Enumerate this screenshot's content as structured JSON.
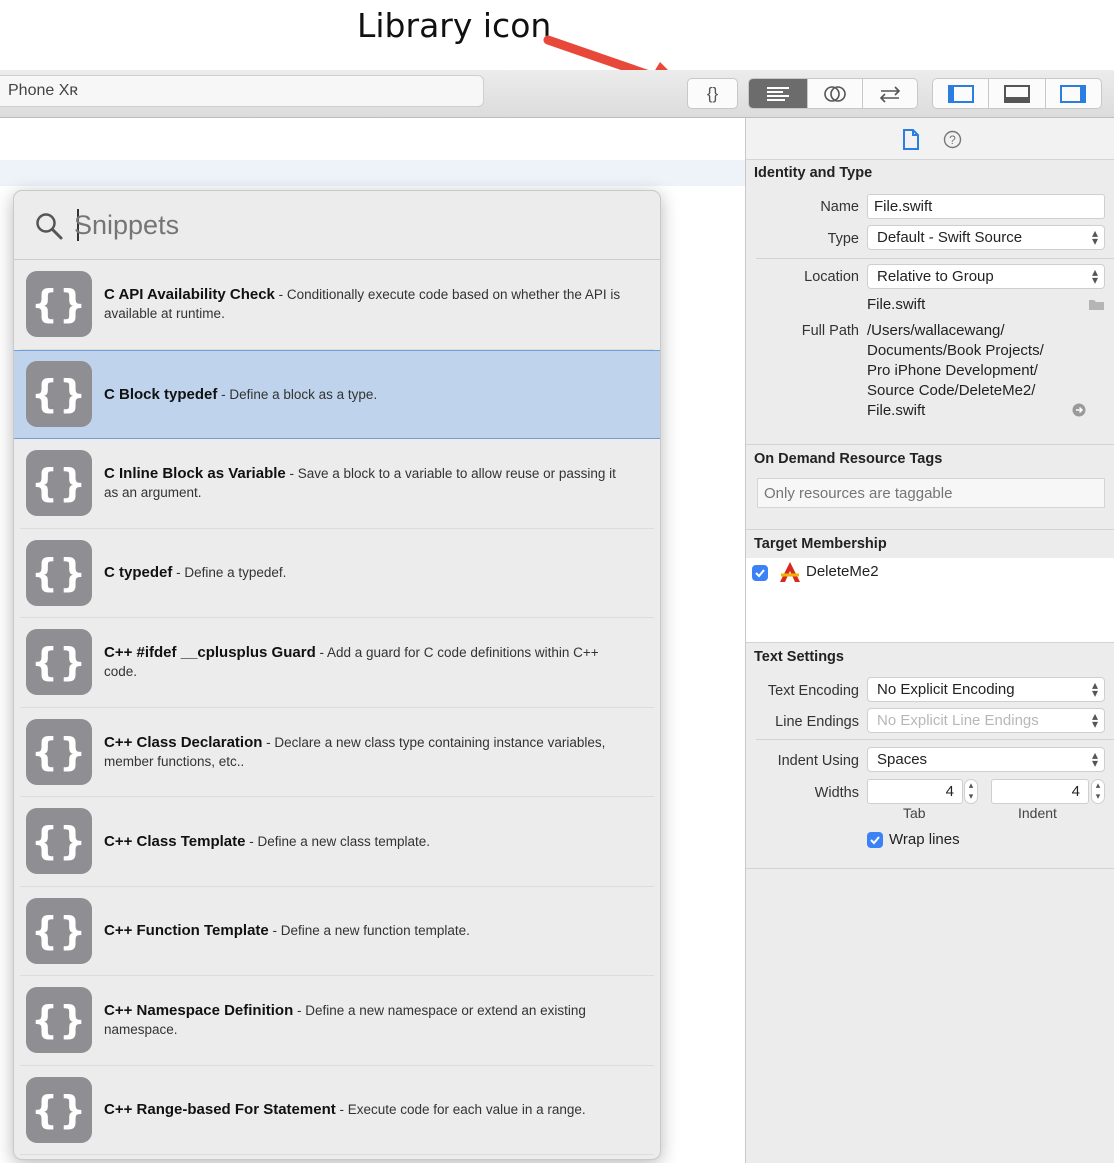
{
  "annotation": {
    "label": "Library icon"
  },
  "toolbar": {
    "scheme_label": "Phone Xʀ",
    "library_button_label": "{}",
    "editor_standard_icon": "align-left-icon",
    "editor_assistant_icon": "venn-circles-icon",
    "editor_version_icon": "swap-arrows-icon",
    "navigator_toggle_icon": "left-panel-icon",
    "debug_toggle_icon": "bottom-panel-icon",
    "inspector_toggle_icon": "right-panel-icon"
  },
  "library": {
    "search_placeholder": "Snippets",
    "items": [
      {
        "title": "C API Availability Check",
        "desc": " - Conditionally execute code based on whether the API is available at runtime."
      },
      {
        "title": "C Block typedef",
        "desc": " - Define a block as a type."
      },
      {
        "title": "C Inline Block as Variable",
        "desc": " - Save a block to a variable to allow reuse or passing it as an argument."
      },
      {
        "title": "C typedef",
        "desc": " - Define a typedef."
      },
      {
        "title": "C++ #ifdef __cplusplus Guard",
        "desc": " - Add a guard for C code definitions within C++ code."
      },
      {
        "title": "C++ Class Declaration",
        "desc": " - Declare a new class type containing instance variables, member functions, etc.."
      },
      {
        "title": "C++ Class Template",
        "desc": " - Define a new class template."
      },
      {
        "title": "C++ Function Template",
        "desc": " - Define a new function template."
      },
      {
        "title": "C++ Namespace Definition",
        "desc": " - Define a new namespace or extend an existing namespace."
      },
      {
        "title": "C++ Range-based For Statement",
        "desc": " - Execute code for each value in a range."
      }
    ],
    "icon_glyph": "{}"
  },
  "inspector": {
    "identity": {
      "title": "Identity and Type",
      "name_label": "Name",
      "name_value": "File.swift",
      "type_label": "Type",
      "type_value": "Default - Swift Source",
      "location_label": "Location",
      "location_value": "Relative to Group",
      "location_file": "File.swift",
      "fullpath_label": "Full Path",
      "fullpath_lines": [
        "/Users/wallacewang/",
        "Documents/Book Projects/",
        "Pro iPhone Development/",
        "Source Code/DeleteMe2/",
        "File.swift"
      ]
    },
    "tags": {
      "title": "On Demand Resource Tags",
      "placeholder": "Only resources are taggable"
    },
    "target": {
      "title": "Target Membership",
      "target_name": "DeleteMe2",
      "checked": true
    },
    "text_settings": {
      "title": "Text Settings",
      "encoding_label": "Text Encoding",
      "encoding_value": "No Explicit Encoding",
      "line_endings_label": "Line Endings",
      "line_endings_value": "No Explicit Line Endings",
      "indent_label": "Indent Using",
      "indent_value": "Spaces",
      "widths_label": "Widths",
      "tab_width": "4",
      "indent_width": "4",
      "tab_caption": "Tab",
      "indent_caption": "Indent",
      "wrap_label": "Wrap lines",
      "wrap_checked": true
    }
  },
  "colors": {
    "accent": "#3b82f6",
    "selection": "#bfd4ec",
    "annotation_arrow": "#e8483a"
  }
}
